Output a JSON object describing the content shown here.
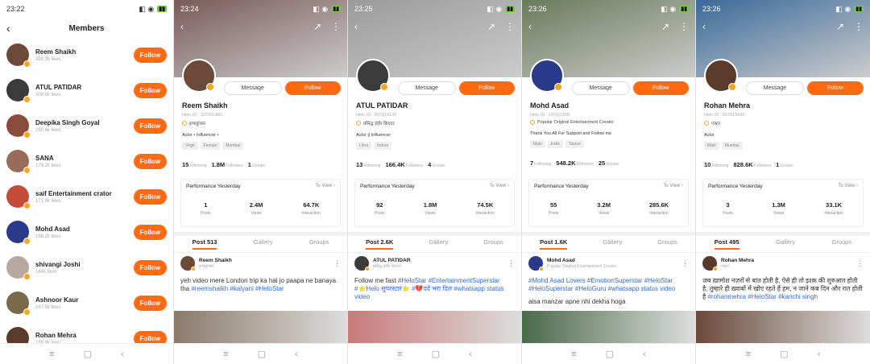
{
  "members_screen": {
    "time": "23:22",
    "title": "Members",
    "follow_label": "Follow",
    "items": [
      {
        "name": "Reem Shaikh",
        "likes": "358.3k likes",
        "color": "#6b4a3a"
      },
      {
        "name": "ATUL PATIDAR",
        "likes": "308.9k likes",
        "color": "#3b3b3b"
      },
      {
        "name": "Deepika Singh Goyal",
        "likes": "290.6k likes",
        "color": "#8a4c3c"
      },
      {
        "name": "SANA",
        "likes": "178.2k likes",
        "color": "#9a6a5a"
      },
      {
        "name": "saif Entertainment crator",
        "likes": "171.9k likes",
        "color": "#c44a3a"
      },
      {
        "name": "Mohd Asad",
        "likes": "156.2k likes",
        "color": "#2a3a8a"
      },
      {
        "name": "shivangi Joshi",
        "likes": "164k likes",
        "color": "#b8a8a0"
      },
      {
        "name": "Ashnoor Kaur",
        "likes": "167.5k likes",
        "color": "#7a6a4a"
      },
      {
        "name": "Rohan Mehra",
        "likes": "159.8k likes",
        "color": "#5a3a2a"
      }
    ]
  },
  "common": {
    "message_label": "Message",
    "follow_label": "Follow",
    "following_label": "Following",
    "followers_label": "Followers",
    "groups_label": "Groups",
    "performance_label": "Performance Yesterday",
    "to_view_label": "To View",
    "posts_label": "Posts",
    "views_label": "Views",
    "interaction_label": "Interaction",
    "gallery_label": "Gallery"
  },
  "profiles": [
    {
      "time": "23:24",
      "name": "Reem Shaikh",
      "helo_id": "Helo ID : 337991881",
      "tag": "इन्फ्लुएंसर",
      "bio": "Actor • Influencer •",
      "chips": [
        "Virgo",
        "Female",
        "Mumbai"
      ],
      "following": "15",
      "followers": "1.8M",
      "groups": "1",
      "perf": {
        "posts": "1",
        "views": "2.4M",
        "interaction": "64.7K"
      },
      "post_tab": "Post 513",
      "show_groups": true,
      "post_author": "Reem Shaikh",
      "post_sub": "इन्फ्लुएंसर",
      "post_text": "yeh video mere London trip ka hai jo paapa ne banaya tha",
      "post_hash": "#reemshaikh  #kalyani #HeloStar",
      "cover_color": "#7a5a5a",
      "avatar_color": "#6b4a3a",
      "img_color": "#8a7a6a"
    },
    {
      "time": "23:25",
      "name": "ATUL PATIDAR",
      "helo_id": "Helo ID : 807916120",
      "tag": "प्रसिद्ध इंदौर क्रिएटर",
      "bio": "Actor || Influencer",
      "chips": [
        "Libra",
        "Indore"
      ],
      "following": "13",
      "followers": "166.4K",
      "groups": "4",
      "perf": {
        "posts": "92",
        "views": "1.8M",
        "interaction": "74.5K"
      },
      "post_tab": "Post 2.6K",
      "show_groups": false,
      "post_author": "ATUL PATIDAR",
      "post_sub": "प्रसिद्ध इंदौर क्रिएटर",
      "post_text": "Follow me fast",
      "post_hash": "#HeloStar #EntertainmentSuperstar #⭐Helo सुपरस्टार⭐ #💔दर्द भरा दिल #whatsapp status video",
      "cover_color": "#9a9a9a",
      "avatar_color": "#3b3b3b",
      "img_color": "#c87a7a"
    },
    {
      "time": "23:26",
      "name": "Mohd Asad",
      "helo_id": "Helo ID : 1970/1308",
      "tag": "Popular Original Entertainment Creator",
      "bio": "Thank You All For Support and Follow me",
      "chips": [
        "Male",
        "India",
        "Taurus"
      ],
      "following": "7",
      "followers": "548.2K",
      "groups": "25",
      "perf": {
        "posts": "55",
        "views": "3.2M",
        "interaction": "285.6K"
      },
      "post_tab": "Post 1.6K",
      "show_groups": false,
      "post_author": "Mohd Asad",
      "post_sub": "Popular Original Entertainment Creator",
      "post_text": "",
      "post_hash": "#Mohd Asad Lovers  #EmotionSuperstar #HeloStar  #HeloSuperstar #HeloGuru #whatsapp status video",
      "post_extra": "aisa manzar apne nhi dekha hoga",
      "cover_color": "#6a7a5a",
      "avatar_color": "#2a3a8a",
      "img_color": "#4a6a4a"
    },
    {
      "time": "23:26",
      "name": "Rohan Mehra",
      "helo_id": "Helo ID : 557815643",
      "tag": "एक्टर",
      "bio": "Actor",
      "chips": [
        "Male",
        "Mumbai"
      ],
      "following": "10",
      "followers": "828.6K",
      "groups": "1",
      "perf": {
        "posts": "3",
        "views": "1.3M",
        "interaction": "33.1K"
      },
      "post_tab": "Post 495",
      "show_groups": true,
      "post_author": "Rohan Mehra",
      "post_sub": "एक्टर",
      "post_text": "जब ख़ामोश नज़रों से बात होती है, ऐसे ही तो इश्क़ की शुरुआत होती है, तुम्हारे ही ख़्वाबों में खोए रहते हैं हम, न जाने कब दिन और रात होती है",
      "post_hash": "#rohanmehra  #HeloStar  #kanchi singh",
      "cover_color": "#3a6a9a",
      "avatar_color": "#5a3a2a",
      "img_color": "#6a4a3a"
    }
  ]
}
